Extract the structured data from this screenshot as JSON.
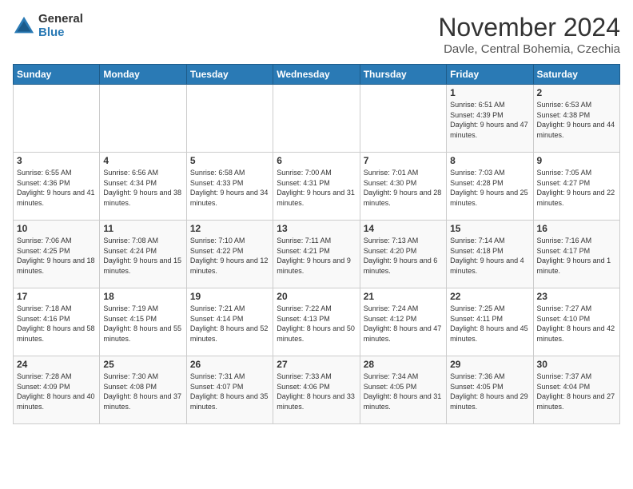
{
  "logo": {
    "general": "General",
    "blue": "Blue"
  },
  "title": "November 2024",
  "subtitle": "Davle, Central Bohemia, Czechia",
  "days_of_week": [
    "Sunday",
    "Monday",
    "Tuesday",
    "Wednesday",
    "Thursday",
    "Friday",
    "Saturday"
  ],
  "weeks": [
    [
      {
        "day": "",
        "info": ""
      },
      {
        "day": "",
        "info": ""
      },
      {
        "day": "",
        "info": ""
      },
      {
        "day": "",
        "info": ""
      },
      {
        "day": "",
        "info": ""
      },
      {
        "day": "1",
        "info": "Sunrise: 6:51 AM\nSunset: 4:39 PM\nDaylight: 9 hours and 47 minutes."
      },
      {
        "day": "2",
        "info": "Sunrise: 6:53 AM\nSunset: 4:38 PM\nDaylight: 9 hours and 44 minutes."
      }
    ],
    [
      {
        "day": "3",
        "info": "Sunrise: 6:55 AM\nSunset: 4:36 PM\nDaylight: 9 hours and 41 minutes."
      },
      {
        "day": "4",
        "info": "Sunrise: 6:56 AM\nSunset: 4:34 PM\nDaylight: 9 hours and 38 minutes."
      },
      {
        "day": "5",
        "info": "Sunrise: 6:58 AM\nSunset: 4:33 PM\nDaylight: 9 hours and 34 minutes."
      },
      {
        "day": "6",
        "info": "Sunrise: 7:00 AM\nSunset: 4:31 PM\nDaylight: 9 hours and 31 minutes."
      },
      {
        "day": "7",
        "info": "Sunrise: 7:01 AM\nSunset: 4:30 PM\nDaylight: 9 hours and 28 minutes."
      },
      {
        "day": "8",
        "info": "Sunrise: 7:03 AM\nSunset: 4:28 PM\nDaylight: 9 hours and 25 minutes."
      },
      {
        "day": "9",
        "info": "Sunrise: 7:05 AM\nSunset: 4:27 PM\nDaylight: 9 hours and 22 minutes."
      }
    ],
    [
      {
        "day": "10",
        "info": "Sunrise: 7:06 AM\nSunset: 4:25 PM\nDaylight: 9 hours and 18 minutes."
      },
      {
        "day": "11",
        "info": "Sunrise: 7:08 AM\nSunset: 4:24 PM\nDaylight: 9 hours and 15 minutes."
      },
      {
        "day": "12",
        "info": "Sunrise: 7:10 AM\nSunset: 4:22 PM\nDaylight: 9 hours and 12 minutes."
      },
      {
        "day": "13",
        "info": "Sunrise: 7:11 AM\nSunset: 4:21 PM\nDaylight: 9 hours and 9 minutes."
      },
      {
        "day": "14",
        "info": "Sunrise: 7:13 AM\nSunset: 4:20 PM\nDaylight: 9 hours and 6 minutes."
      },
      {
        "day": "15",
        "info": "Sunrise: 7:14 AM\nSunset: 4:18 PM\nDaylight: 9 hours and 4 minutes."
      },
      {
        "day": "16",
        "info": "Sunrise: 7:16 AM\nSunset: 4:17 PM\nDaylight: 9 hours and 1 minute."
      }
    ],
    [
      {
        "day": "17",
        "info": "Sunrise: 7:18 AM\nSunset: 4:16 PM\nDaylight: 8 hours and 58 minutes."
      },
      {
        "day": "18",
        "info": "Sunrise: 7:19 AM\nSunset: 4:15 PM\nDaylight: 8 hours and 55 minutes."
      },
      {
        "day": "19",
        "info": "Sunrise: 7:21 AM\nSunset: 4:14 PM\nDaylight: 8 hours and 52 minutes."
      },
      {
        "day": "20",
        "info": "Sunrise: 7:22 AM\nSunset: 4:13 PM\nDaylight: 8 hours and 50 minutes."
      },
      {
        "day": "21",
        "info": "Sunrise: 7:24 AM\nSunset: 4:12 PM\nDaylight: 8 hours and 47 minutes."
      },
      {
        "day": "22",
        "info": "Sunrise: 7:25 AM\nSunset: 4:11 PM\nDaylight: 8 hours and 45 minutes."
      },
      {
        "day": "23",
        "info": "Sunrise: 7:27 AM\nSunset: 4:10 PM\nDaylight: 8 hours and 42 minutes."
      }
    ],
    [
      {
        "day": "24",
        "info": "Sunrise: 7:28 AM\nSunset: 4:09 PM\nDaylight: 8 hours and 40 minutes."
      },
      {
        "day": "25",
        "info": "Sunrise: 7:30 AM\nSunset: 4:08 PM\nDaylight: 8 hours and 37 minutes."
      },
      {
        "day": "26",
        "info": "Sunrise: 7:31 AM\nSunset: 4:07 PM\nDaylight: 8 hours and 35 minutes."
      },
      {
        "day": "27",
        "info": "Sunrise: 7:33 AM\nSunset: 4:06 PM\nDaylight: 8 hours and 33 minutes."
      },
      {
        "day": "28",
        "info": "Sunrise: 7:34 AM\nSunset: 4:05 PM\nDaylight: 8 hours and 31 minutes."
      },
      {
        "day": "29",
        "info": "Sunrise: 7:36 AM\nSunset: 4:05 PM\nDaylight: 8 hours and 29 minutes."
      },
      {
        "day": "30",
        "info": "Sunrise: 7:37 AM\nSunset: 4:04 PM\nDaylight: 8 hours and 27 minutes."
      }
    ]
  ]
}
